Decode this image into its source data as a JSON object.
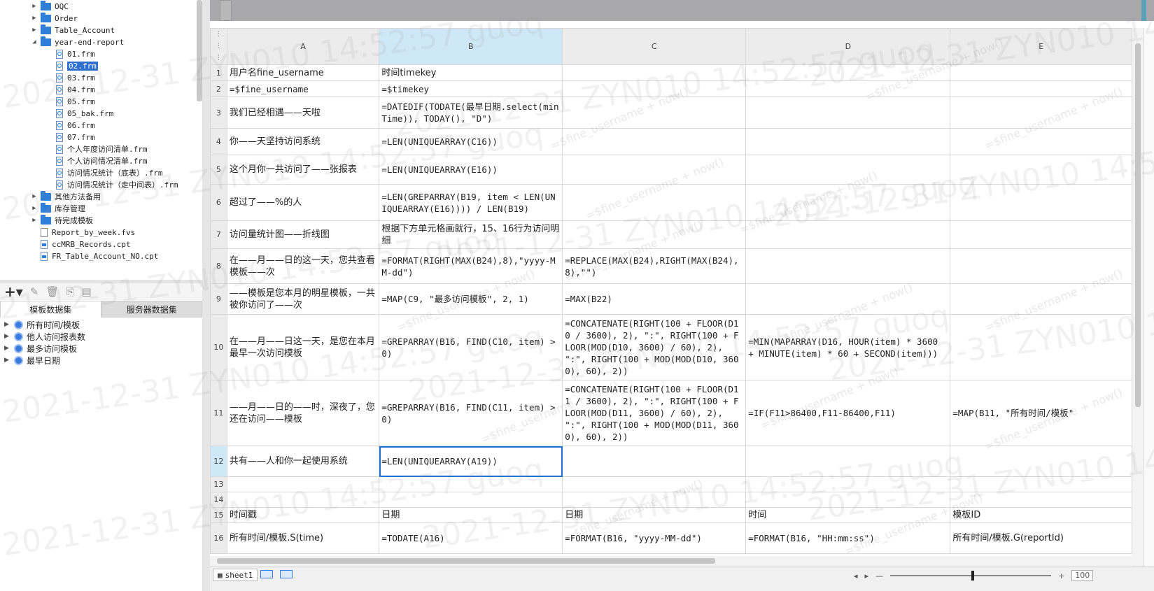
{
  "tree": {
    "items": [
      {
        "label": "OQC",
        "kind": "folder",
        "expanded": false
      },
      {
        "label": "Order",
        "kind": "folder",
        "expanded": false
      },
      {
        "label": "Table_Account",
        "kind": "folder",
        "expanded": false
      },
      {
        "label": "year-end-report",
        "kind": "folder",
        "expanded": true
      },
      {
        "label": "01.frm",
        "kind": "frm"
      },
      {
        "label": "02.frm",
        "kind": "frm",
        "selected": true
      },
      {
        "label": "03.frm",
        "kind": "frm"
      },
      {
        "label": "04.frm",
        "kind": "frm"
      },
      {
        "label": "05.frm",
        "kind": "frm"
      },
      {
        "label": "05_bak.frm",
        "kind": "frm"
      },
      {
        "label": "06.frm",
        "kind": "frm"
      },
      {
        "label": "07.frm",
        "kind": "frm"
      },
      {
        "label": "个人年度访问清单.frm",
        "kind": "frm"
      },
      {
        "label": "个人访问情况清单.frm",
        "kind": "frm"
      },
      {
        "label": "访问情况统计（底表）.frm",
        "kind": "frm"
      },
      {
        "label": "访问情况统计（走中间表）.frm",
        "kind": "frm"
      },
      {
        "label": "其他方法备用",
        "kind": "folder",
        "expanded": false
      },
      {
        "label": "库存管理",
        "kind": "folder",
        "expanded": false
      },
      {
        "label": "待完成模板",
        "kind": "folder",
        "expanded": false
      },
      {
        "label": "Report_by_week.fvs",
        "kind": "doc"
      },
      {
        "label": "ccMRB_Records.cpt",
        "kind": "cpt"
      },
      {
        "label": "FR_Table_Account_NO.cpt",
        "kind": "cpt"
      }
    ]
  },
  "dataset_tabs": {
    "template": "模板数据集",
    "server": "服务器数据集"
  },
  "datasets": [
    "所有时间/模板",
    "他人访问报表数",
    "最多访问模板",
    "最早日期"
  ],
  "grid": {
    "columns": [
      "A",
      "B",
      "C",
      "D",
      "E"
    ],
    "rows": [
      {
        "n": "1",
        "A": "用户名fine_username",
        "B": "时间timekey",
        "C": "",
        "D": "",
        "E": ""
      },
      {
        "n": "2",
        "A": "=$fine_username",
        "B": "=$timekey",
        "C": "",
        "D": "",
        "E": ""
      },
      {
        "n": "3",
        "A": "我们已经相遇——天啦",
        "B": "=DATEDIF(TODATE(最早日期.select(minTime)), TODAY(), \"D\")",
        "C": "",
        "D": "",
        "E": ""
      },
      {
        "n": "4",
        "A": "你——天坚持访问系统",
        "B": "=LEN(UNIQUEARRAY(C16))",
        "C": "",
        "D": "",
        "E": ""
      },
      {
        "n": "5",
        "A": "这个月你一共访问了——张报表",
        "B": "=LEN(UNIQUEARRAY(E16))",
        "C": "",
        "D": "",
        "E": ""
      },
      {
        "n": "6",
        "A": "超过了——%的人",
        "B": "=LEN(GREPARRAY(B19, item < LEN(UNIQUEARRAY(E16)))) / LEN(B19)",
        "C": "",
        "D": "",
        "E": ""
      },
      {
        "n": "7",
        "A": "访问量统计图——折线图",
        "B": "根据下方单元格画就行，15、16行为访问明细",
        "C": "",
        "D": "",
        "E": ""
      },
      {
        "n": "8",
        "A": "在——月——日的这一天，您共查看模板——次",
        "B": "=FORMAT(RIGHT(MAX(B24),8),\"yyyy-MM-dd\")",
        "C": "=REPLACE(MAX(B24),RIGHT(MAX(B24),8),\"\")",
        "D": "",
        "E": ""
      },
      {
        "n": "9",
        "A": "——模板是您本月的明星模板，一共被你访问了——次",
        "B": "=MAP(C9, \"最多访问模板\", 2, 1)",
        "C": "=MAX(B22)",
        "D": "",
        "E": ""
      },
      {
        "n": "10",
        "A": "在——月——日这一天，是您在本月最早一次访问模板",
        "B": "=GREPARRAY(B16, FIND(C10, item) > 0)",
        "C": "=CONCATENATE(RIGHT(100 + FLOOR(D10 / 3600), 2), \":\", RIGHT(100 + FLOOR(MOD(D10, 3600) / 60), 2), \":\", RIGHT(100 + MOD(MOD(D10, 3600), 60), 2))",
        "D": "=MIN(MAPARRAY(D16, HOUR(item) * 3600 + MINUTE(item) * 60 + SECOND(item)))",
        "E": ""
      },
      {
        "n": "11",
        "A": "——月——日的——时，深夜了，您还在访问——模板",
        "B": "=GREPARRAY(B16, FIND(C11, item) > 0)",
        "C": "=CONCATENATE(RIGHT(100 + FLOOR(D11 / 3600), 2), \":\", RIGHT(100 + FLOOR(MOD(D11, 3600) / 60), 2), \":\", RIGHT(100 + MOD(MOD(D11, 3600), 60), 2))",
        "D": "=IF(F11>86400,F11-86400,F11)",
        "E": "=MAP(B11, \"所有时间/模板\""
      },
      {
        "n": "12",
        "A": "共有——人和你一起使用系统",
        "B": "=LEN(UNIQUEARRAY(A19))",
        "C": "",
        "D": "",
        "E": ""
      },
      {
        "n": "13",
        "A": "",
        "B": "",
        "C": "",
        "D": "",
        "E": ""
      },
      {
        "n": "14",
        "A": "",
        "B": "",
        "C": "",
        "D": "",
        "E": ""
      },
      {
        "n": "15",
        "A": "时间戳",
        "B": "日期",
        "C": "日期",
        "D": "时间",
        "E": "模板ID"
      },
      {
        "n": "16",
        "A": "所有时间/模板.S(time)",
        "B": "=TODATE(A16)",
        "C": "=FORMAT(B16, \"yyyy-MM-dd\")",
        "D": "=FORMAT(B16, \"HH:mm:ss\")",
        "E": "所有时间/模板.G(reportId)"
      }
    ]
  },
  "status": {
    "sheet": "sheet1",
    "zoom": "100",
    "zoom_minus": "—",
    "zoom_plus": "+"
  },
  "watermark": {
    "big": "2021-12-31 ZYN010 14:52:57 guoq",
    "small": "=$fine_username + now()"
  }
}
